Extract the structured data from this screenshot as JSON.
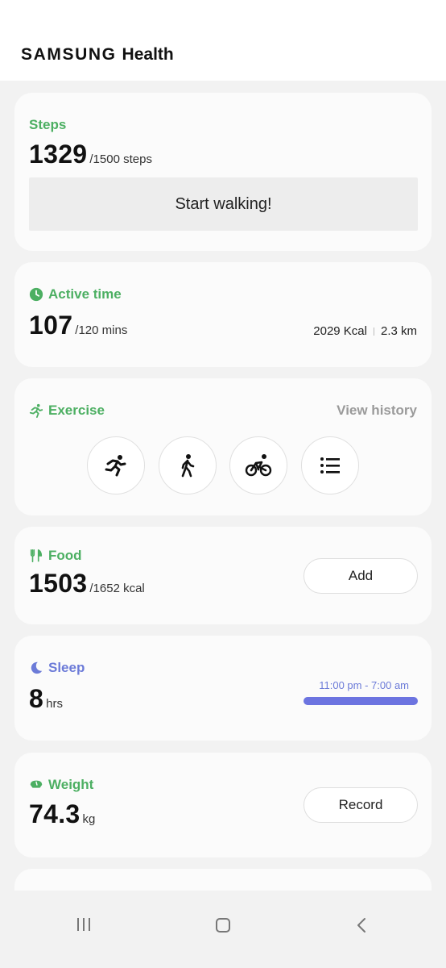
{
  "app": {
    "brand_primary": "SAMSUNG",
    "brand_secondary": "Health"
  },
  "colors": {
    "green": "#4caf62",
    "blue": "#6c7bd8",
    "sleep_bar": "#6c74e0"
  },
  "steps": {
    "title": "Steps",
    "value": "1329",
    "goal": "/1500 steps",
    "button": "Start walking!"
  },
  "active": {
    "title": "Active time",
    "icon": "clock-icon",
    "value": "107",
    "goal": "/120 mins",
    "kcal": "2029 Kcal",
    "distance": "2.3 km"
  },
  "exercise": {
    "title": "Exercise",
    "icon": "running-icon",
    "history_label": "View history",
    "buttons": [
      "running-icon",
      "walking-icon",
      "cycling-icon",
      "list-icon"
    ]
  },
  "food": {
    "title": "Food",
    "icon": "fork-knife-icon",
    "value": "1503",
    "goal": "/1652 kcal",
    "button": "Add"
  },
  "sleep": {
    "title": "Sleep",
    "icon": "moon-icon",
    "value": "8",
    "unit": "hrs",
    "range": "11:00 pm - 7:00 am"
  },
  "weight": {
    "title": "Weight",
    "icon": "scale-icon",
    "value": "74.3",
    "unit": "kg",
    "button": "Record"
  },
  "navbar": {
    "icons": [
      "recent-apps-icon",
      "home-icon",
      "back-icon"
    ]
  }
}
